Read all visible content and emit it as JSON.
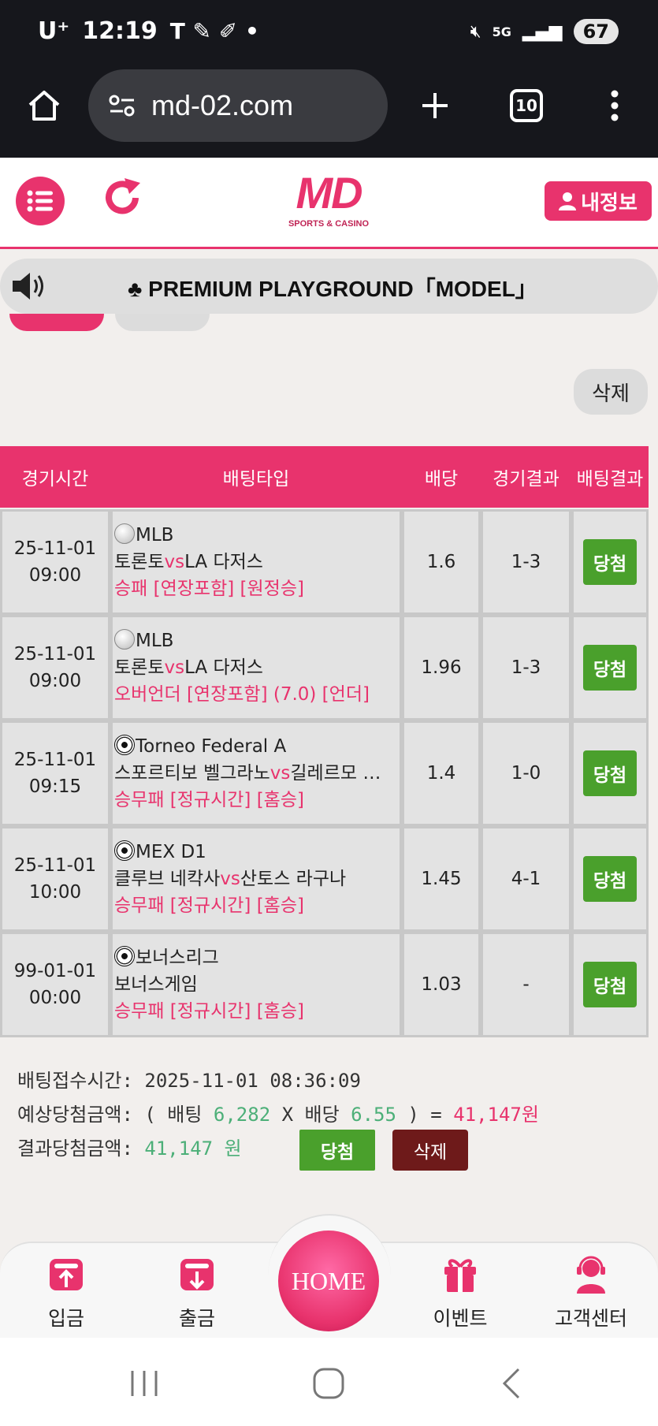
{
  "status_bar": {
    "carrier": "U⁺",
    "time": "12:19",
    "network": "5G",
    "battery": "67"
  },
  "browser": {
    "url": "md-02.com",
    "tab_count": "10"
  },
  "header": {
    "logo_text": "MD",
    "logo_sub": "SPORTS & CASINO",
    "my_info_label": "내정보"
  },
  "marquee": {
    "text": "♣ PREMIUM PLAYGROUND「MODEL」"
  },
  "actions": {
    "delete_label": "삭제"
  },
  "table": {
    "headers": {
      "time": "경기시간",
      "type": "배팅타입",
      "odds": "배당",
      "game_result": "경기결과",
      "bet_result": "배팅결과"
    },
    "rows": [
      {
        "date": "25-11-01",
        "time": "09:00",
        "league": "MLB",
        "sport": "baseball",
        "home": "토론토",
        "vs": "vs",
        "away": "LA 다저스",
        "market": "승패 [연장포함] [원정승]",
        "odds": "1.6",
        "score": "1-3",
        "result": "당첨"
      },
      {
        "date": "25-11-01",
        "time": "09:00",
        "league": "MLB",
        "sport": "baseball",
        "home": "토론토",
        "vs": "vs",
        "away": "LA 다저스",
        "market": "오버언더 [연장포함] (7.0) [언더]",
        "odds": "1.96",
        "score": "1-3",
        "result": "당첨"
      },
      {
        "date": "25-11-01",
        "time": "09:15",
        "league": "Torneo Federal A",
        "sport": "soccer",
        "home": "스포르티보 벨그라노",
        "vs": "vs",
        "away": "길레르모 …",
        "market": "승무패 [정규시간] [홈승]",
        "odds": "1.4",
        "score": "1-0",
        "result": "당첨"
      },
      {
        "date": "25-11-01",
        "time": "10:00",
        "league": "MEX D1",
        "sport": "soccer",
        "home": "클루브 네칵사",
        "vs": "vs",
        "away": "산토스 라구나",
        "market": "승무패 [정규시간] [홈승]",
        "odds": "1.45",
        "score": "4-1",
        "result": "당첨"
      },
      {
        "date": "99-01-01",
        "time": "00:00",
        "league": "보너스리그",
        "sport": "soccer",
        "home": "보너스게임",
        "vs": "",
        "away": "",
        "market": "승무패 [정규시간] [홈승]",
        "odds": "1.03",
        "score": "-",
        "result": "당첨"
      }
    ]
  },
  "summary": {
    "receipt_label": "배팅접수시간:",
    "receipt_time": "2025-11-01 08:36:09",
    "expected_label": "예상당첨금액:",
    "expected_open": "( 배팅",
    "bet_amount": "6,282",
    "times": "X 배당",
    "total_odds": "6.55",
    "expected_close": ") =",
    "expected_win": "41,147원",
    "result_label": "결과당첨금액:",
    "result_amount": "41,147 원",
    "win_label": "당첨",
    "delete_label": "삭제"
  },
  "bottom_nav": {
    "deposit": "입금",
    "withdraw": "출금",
    "home": "HOME",
    "event": "이벤트",
    "support": "고객센터"
  },
  "colors": {
    "brand_pink": "#e8336d",
    "win_green": "#4aa02c",
    "delete_maroon": "#6e1a1a"
  }
}
